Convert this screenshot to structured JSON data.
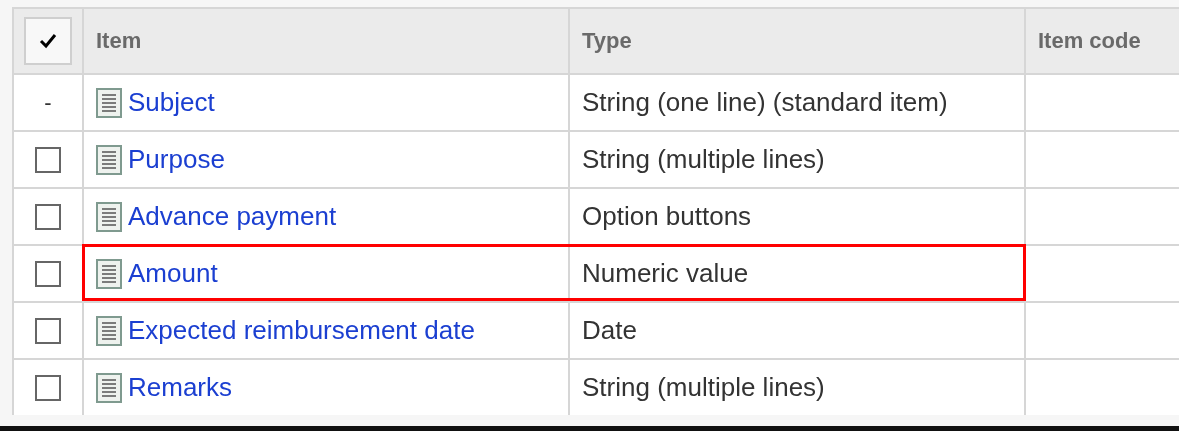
{
  "table": {
    "select_all": {
      "checked": true
    },
    "columns": [
      "Item",
      "Type",
      "Item code"
    ],
    "rows": [
      {
        "kind": "dash",
        "marker": "-",
        "item": "Subject",
        "type": "String (one line) (standard item)",
        "highlighted": false
      },
      {
        "kind": "checkbox",
        "checked": false,
        "item": "Purpose",
        "type": "String (multiple lines)",
        "highlighted": false
      },
      {
        "kind": "checkbox",
        "checked": false,
        "item": "Advance payment",
        "type": "Option buttons",
        "highlighted": false
      },
      {
        "kind": "checkbox",
        "checked": false,
        "item": "Amount",
        "type": "Numeric value",
        "highlighted": true
      },
      {
        "kind": "checkbox",
        "checked": false,
        "item": "Expected reimbursement date",
        "type": "Date",
        "highlighted": false
      },
      {
        "kind": "checkbox",
        "checked": false,
        "item": "Remarks",
        "type": "String (multiple lines)",
        "highlighted": false
      }
    ]
  }
}
